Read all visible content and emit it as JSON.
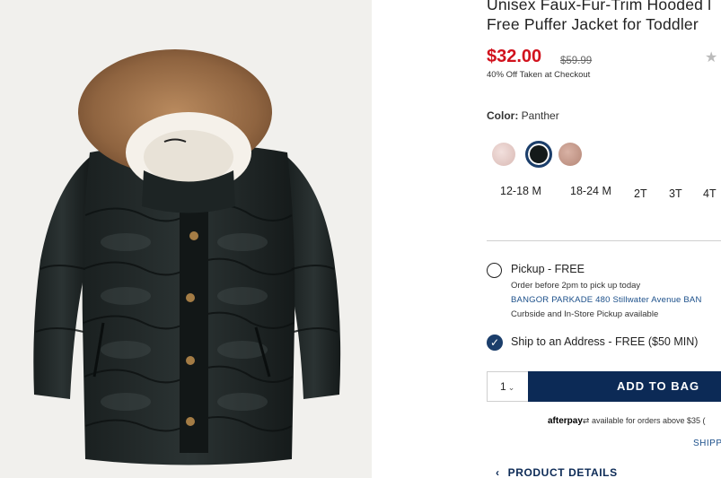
{
  "product": {
    "title_line1": "Unisex Faux-Fur-Trim Hooded l",
    "title_line2": "Free Puffer Jacket for Toddler",
    "sale_price": "$32.00",
    "original_price": "$59.99",
    "discount_note": "40% Off Taken at Checkout",
    "rating_icon": "star-icon"
  },
  "color": {
    "label": "Color:",
    "value": "Panther",
    "swatches": [
      {
        "name": "pink",
        "hex": "#e5cbc6"
      },
      {
        "name": "panther",
        "hex": "#141a1a",
        "selected": true
      },
      {
        "name": "rose",
        "hex": "#c69b8b"
      }
    ]
  },
  "sizes": [
    "12-18 M",
    "18-24 M",
    "2T",
    "3T",
    "4T"
  ],
  "fulfillment": {
    "pickup_label": "Pickup - FREE",
    "pickup_note": "Order before 2pm to pick up today",
    "store": "BANGOR PARKADE 480 Stillwater Avenue  BAN",
    "curbside_note": "Curbside and In-Store Pickup available",
    "ship_label": "Ship to an Address - FREE ($50 MIN)",
    "ship_selected": true
  },
  "cart": {
    "quantity": "1",
    "add_label": "ADD TO BAG"
  },
  "afterpay": {
    "brand": "afterpay",
    "note": "available for orders above $35 ("
  },
  "links": {
    "shipping": "SHIPP",
    "product_details": "PRODUCT DETAILS"
  }
}
